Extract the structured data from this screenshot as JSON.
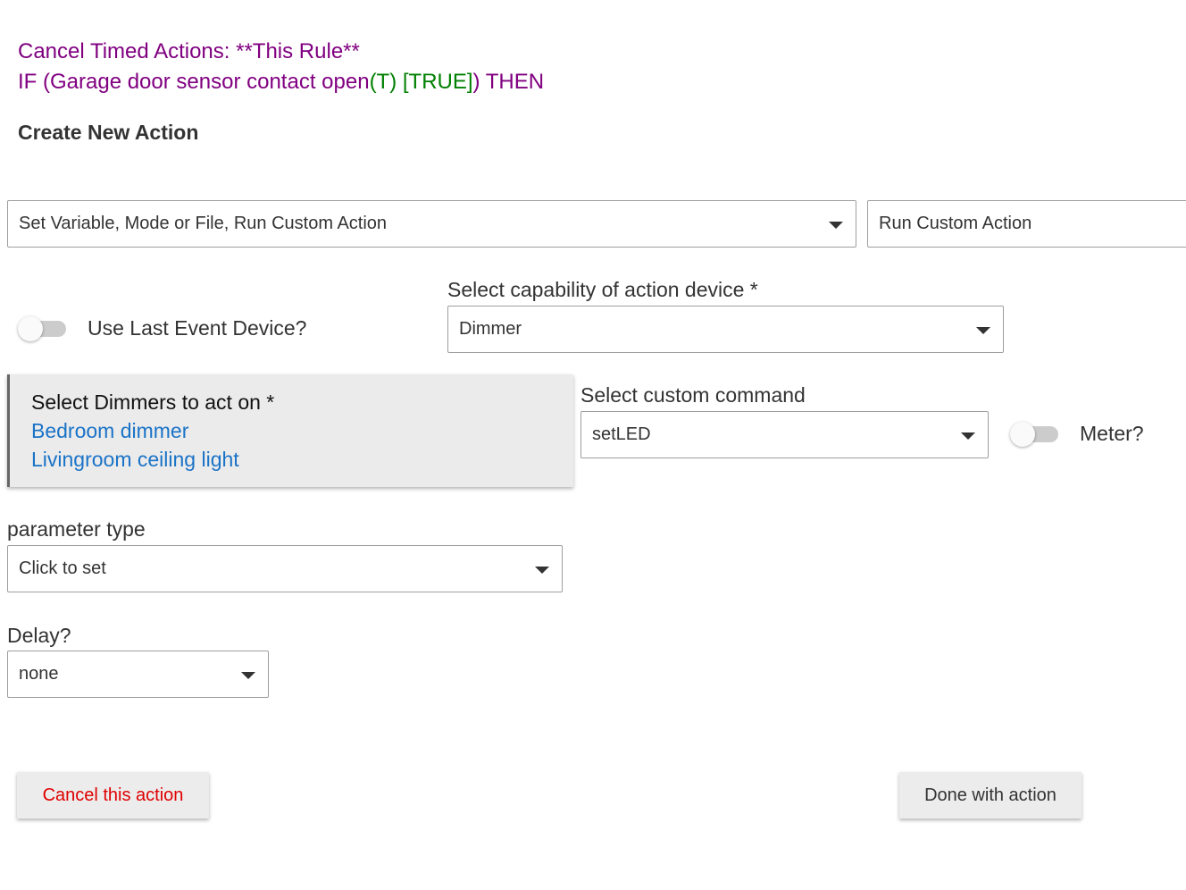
{
  "header": {
    "cancel_timed": "Cancel Timed Actions: **This Rule**",
    "if_prefix": "IF (Garage door sensor contact open",
    "if_state": "(T) [TRUE]",
    "if_suffix": ") THEN",
    "create_heading": "Create New Action"
  },
  "action_type": {
    "selected": "Set Variable, Mode or File, Run Custom Action"
  },
  "action_subtype": {
    "selected": "Run Custom Action"
  },
  "use_last_event": {
    "label": "Use Last Event Device?",
    "on": false
  },
  "capability": {
    "label": "Select capability of action device *",
    "selected": "Dimmer"
  },
  "devices": {
    "label": "Select Dimmers to act on *",
    "items": [
      "Bedroom dimmer",
      "Livingroom ceiling light"
    ]
  },
  "custom_command": {
    "label": "Select custom command",
    "selected": "setLED"
  },
  "meter": {
    "label": "Meter?",
    "on": false
  },
  "parameter_type": {
    "label": "parameter type",
    "selected": "Click to set"
  },
  "delay": {
    "label": "Delay?",
    "selected": "none"
  },
  "buttons": {
    "cancel": "Cancel this action",
    "done": "Done with action"
  },
  "colors": {
    "header_purple": "#800080",
    "header_green": "#008000",
    "device_link": "#1a73c7",
    "cancel_red": "#e00000"
  }
}
